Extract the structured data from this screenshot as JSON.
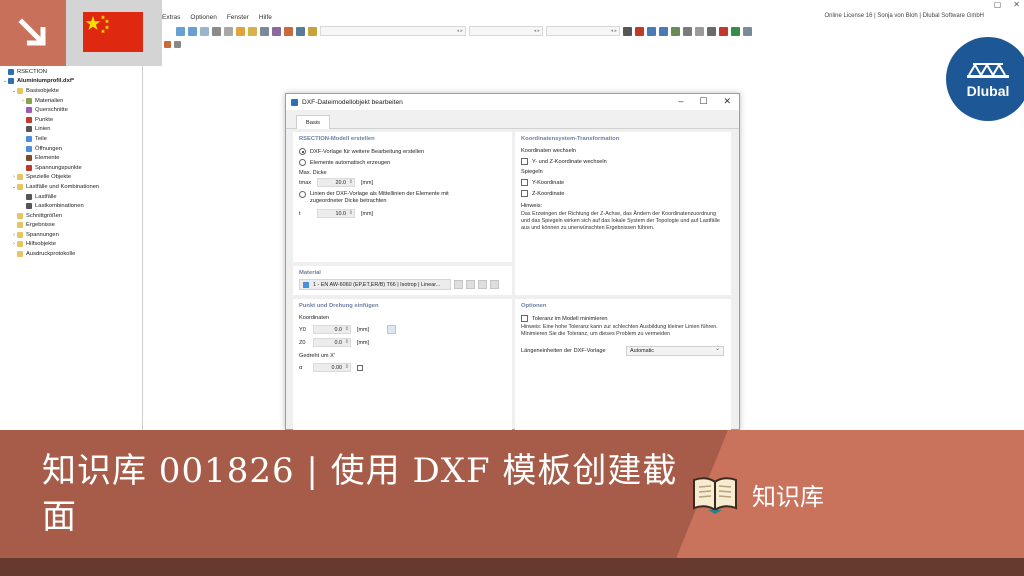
{
  "menubar": {
    "items": [
      "Extras",
      "Optionen",
      "Fenster",
      "Hilfe"
    ],
    "license": "Online License 16 | Sonja von Bloh | Dlubal Software GmbH",
    "window_controls": [
      "▢",
      "✕"
    ]
  },
  "navigator": {
    "items": [
      {
        "label": "RSECTION",
        "level": 0,
        "exp": "",
        "color": "#2e6fb4"
      },
      {
        "label": "Aluminiumprofil.dxf*",
        "level": 0,
        "exp": "⌄",
        "color": "#2e6fb4",
        "bold": true
      },
      {
        "label": "Basisobjekte",
        "level": 1,
        "exp": "⌄",
        "color": "#e8c463"
      },
      {
        "label": "Materialien",
        "level": 2,
        "exp": "›",
        "color": "#8aa24a"
      },
      {
        "label": "Querschnitte",
        "level": 2,
        "exp": "",
        "color": "#a05ab5"
      },
      {
        "label": "Punkte",
        "level": 2,
        "exp": "",
        "color": "#c0392b"
      },
      {
        "label": "Linien",
        "level": 2,
        "exp": "",
        "color": "#555555"
      },
      {
        "label": "Teile",
        "level": 2,
        "exp": "",
        "color": "#4a90d9"
      },
      {
        "label": "Öffnungen",
        "level": 2,
        "exp": "",
        "color": "#4a90d9"
      },
      {
        "label": "Elemente",
        "level": 2,
        "exp": "",
        "color": "#7b4b2a"
      },
      {
        "label": "Spannungspunkte",
        "level": 2,
        "exp": "",
        "color": "#c0392b"
      },
      {
        "label": "Spezielle Objekte",
        "level": 1,
        "exp": "›",
        "color": "#e8c463"
      },
      {
        "label": "Lastfälle und Kombinationen",
        "level": 1,
        "exp": "⌄",
        "color": "#e8c463"
      },
      {
        "label": "Lastfälle",
        "level": 2,
        "exp": "",
        "color": "#555555"
      },
      {
        "label": "Lastkombinationen",
        "level": 2,
        "exp": "",
        "color": "#555555"
      },
      {
        "label": "Schnittgrößen",
        "level": 1,
        "exp": "",
        "color": "#e8c463"
      },
      {
        "label": "Ergebnisse",
        "level": 1,
        "exp": "",
        "color": "#e8c463"
      },
      {
        "label": "Spannungen",
        "level": 1,
        "exp": "›",
        "color": "#e8c463"
      },
      {
        "label": "Hilfsobjekte",
        "level": 1,
        "exp": "›",
        "color": "#e8c463"
      },
      {
        "label": "Ausdruckprotokolle",
        "level": 1,
        "exp": "",
        "color": "#e8c463"
      }
    ]
  },
  "dialog": {
    "title": "DXF-Dateimodellobjekt bearbeiten",
    "tab": "Basis",
    "rsection": {
      "title": "RSECTION-Modell erstellen",
      "opt1": "DXF-Vorlage für weitere Bearbeitung erstellen",
      "opt2": "Elemente automatisch erzeugen",
      "max_thickness": "Max. Dicke",
      "tmax_sym": "tmax",
      "tmax_val": "20.0",
      "unit_mm": "[mm]",
      "opt3": "Linien der DXF-Vorlage als Mittellinien der Elemente mit zugeordneter Dicke betrachten",
      "t_sym": "t",
      "t_val": "10.0"
    },
    "koord": {
      "title": "Koordinatensystem-Transformation",
      "swap_heading": "Koordinaten wechseln",
      "swap_label": "Y- und Z-Koordinate wechseln",
      "mirror_heading": "Spiegeln",
      "mirror_y": "Y-Koordinate",
      "mirror_z": "Z-Koordinate",
      "note_heading": "Hinweis:",
      "note_text": "Das Erzwingen der Richtung der Z-Achse, das Ändern der Koordinatenzuordnung und das Spiegeln wirken sich auf das lokale System der Topologie und auf Lastfälle aus und können zu unerwünschten Ergebnissen führen."
    },
    "material": {
      "title": "Material",
      "value": "1 - EN AW-6060 (EP,ET,ER/B) T66 | Isotrop | Linear..."
    },
    "punkt": {
      "title": "Punkt und Drehung einfügen",
      "coords": "Koordinaten",
      "y0_sym": "Y0",
      "y0_val": "0.0",
      "z0_sym": "Z0",
      "z0_val": "0.0",
      "rot_heading": "Gedreht um X'",
      "alpha_sym": "α",
      "alpha_val": "0.00"
    },
    "optionen": {
      "title": "Optionen",
      "tol_label": "Toleranz im Modell minimieren",
      "tol_hint": "Hinweis: Eine hohe Toleranz kann zur schlechten Ausbildung kleiner Linien führen. Minimieren Sie die Toleranz, um dieses Problem zu vermeiden",
      "units_label": "Längeneinheiten der DXF-Vorlage",
      "units_value": "Automatic"
    }
  },
  "logo": {
    "text": "Dlubal"
  },
  "banner": {
    "title": "知识库 001826 | 使用 DXF 模板创建截面",
    "kb_label": "知识库"
  },
  "colors": {
    "banner": "#a65c48",
    "banner_accent": "#c9735d",
    "footer": "#673a2e",
    "logo": "#1e5796",
    "flag": "#de2910"
  }
}
